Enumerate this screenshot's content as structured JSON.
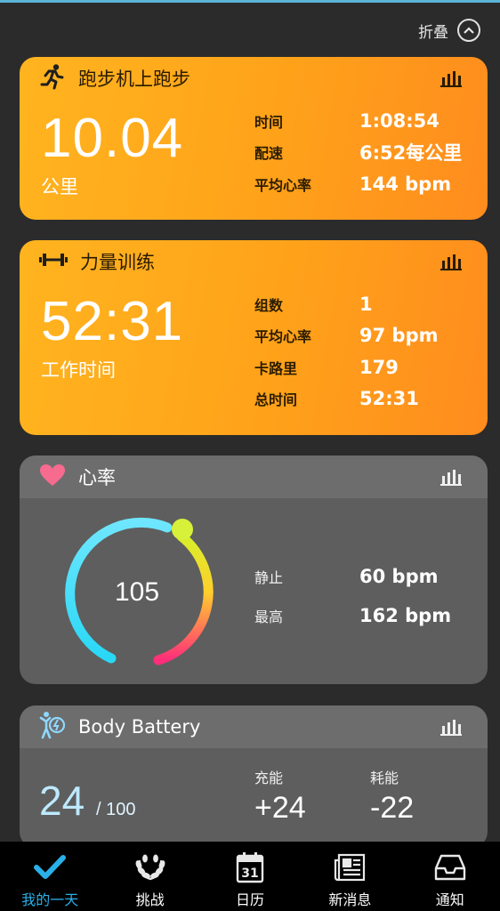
{
  "header": {
    "collapse_label": "折叠"
  },
  "treadmill": {
    "title": "跑步机上跑步",
    "big_value": "10.04",
    "big_unit": "公里",
    "stats": [
      {
        "label": "时间",
        "value": "1:08:54"
      },
      {
        "label": "配速",
        "value": "6:52每公里"
      },
      {
        "label": "平均心率",
        "value": "144 bpm"
      }
    ]
  },
  "strength": {
    "title": "力量训练",
    "big_value": "52:31",
    "big_unit": "工作时间",
    "stats": [
      {
        "label": "组数",
        "value": "1"
      },
      {
        "label": "平均心率",
        "value": "97 bpm"
      },
      {
        "label": "卡路里",
        "value": "179"
      },
      {
        "label": "总时间",
        "value": "52:31"
      }
    ]
  },
  "heart_rate": {
    "title": "心率",
    "current": "105",
    "stats": [
      {
        "label": "静止",
        "value": "60 bpm"
      },
      {
        "label": "最高",
        "value": "162 bpm"
      }
    ]
  },
  "body_battery": {
    "title": "Body Battery",
    "level": "24",
    "max": "/ 100",
    "charged_label": "充能",
    "charged_value": "+24",
    "drained_label": "耗能",
    "drained_value": "-22"
  },
  "nav": [
    {
      "label": "我的一天",
      "icon": "check-icon",
      "active": true
    },
    {
      "label": "挑战",
      "icon": "laurel-icon",
      "active": false
    },
    {
      "label": "日历",
      "icon": "calendar-icon",
      "active": false,
      "badge": "31"
    },
    {
      "label": "新消息",
      "icon": "newsfeed-icon",
      "active": false
    },
    {
      "label": "通知",
      "icon": "inbox-icon",
      "active": false
    }
  ],
  "colors": {
    "accent": "#2ab0e8",
    "card_orange": "#ffa21a",
    "heart_pink": "#f76b8f"
  }
}
